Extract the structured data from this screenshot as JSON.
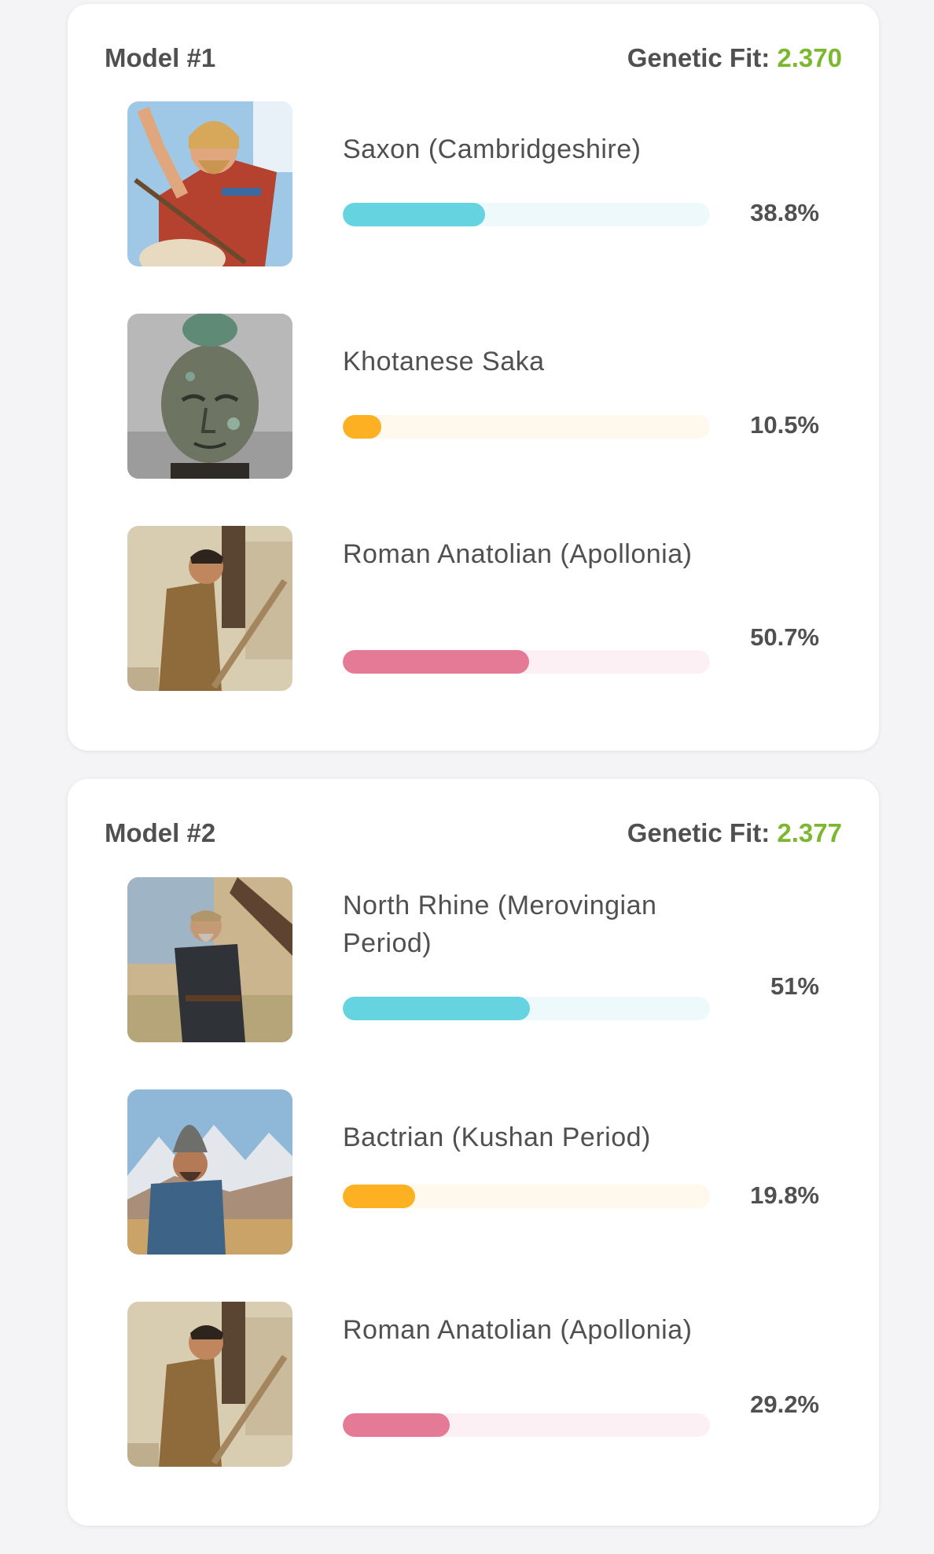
{
  "colors": {
    "fit_green": "#7cb82f",
    "cyan": "#65d3e0",
    "cyan_track": "#eef9fc",
    "orange": "#fdb022",
    "orange_track": "#fff8ec",
    "pink": "#e47a96",
    "pink_track": "#fdf0f4"
  },
  "models": [
    {
      "title": "Model #1",
      "fit_label": "Genetic Fit:",
      "fit_value": "2.370",
      "rows": [
        {
          "name": "Saxon (Cambridgeshire)",
          "percent_label": "38.8%",
          "percent": 38.8,
          "color": "cyan",
          "image": "viking-warrior-portrait"
        },
        {
          "name": "Khotanese Saka",
          "percent_label": "10.5%",
          "percent": 10.5,
          "color": "orange",
          "image": "bronze-head-sculpture"
        },
        {
          "name": "Roman Anatolian (Apollonia)",
          "percent_label": "50.7%",
          "percent": 50.7,
          "color": "pink",
          "image": "roman-laborer-painting"
        }
      ]
    },
    {
      "title": "Model #2",
      "fit_label": "Genetic Fit:",
      "fit_value": "2.377",
      "rows": [
        {
          "name": "North Rhine (Merovingian Period)",
          "percent_label": "51%",
          "percent": 51,
          "color": "cyan",
          "image": "merovingian-man-painting"
        },
        {
          "name": "Bactrian (Kushan Period)",
          "percent_label": "19.8%",
          "percent": 19.8,
          "color": "orange",
          "image": "bactrian-man-mountains"
        },
        {
          "name": "Roman Anatolian (Apollonia)",
          "percent_label": "29.2%",
          "percent": 29.2,
          "color": "pink",
          "image": "roman-laborer-painting"
        }
      ]
    }
  ]
}
